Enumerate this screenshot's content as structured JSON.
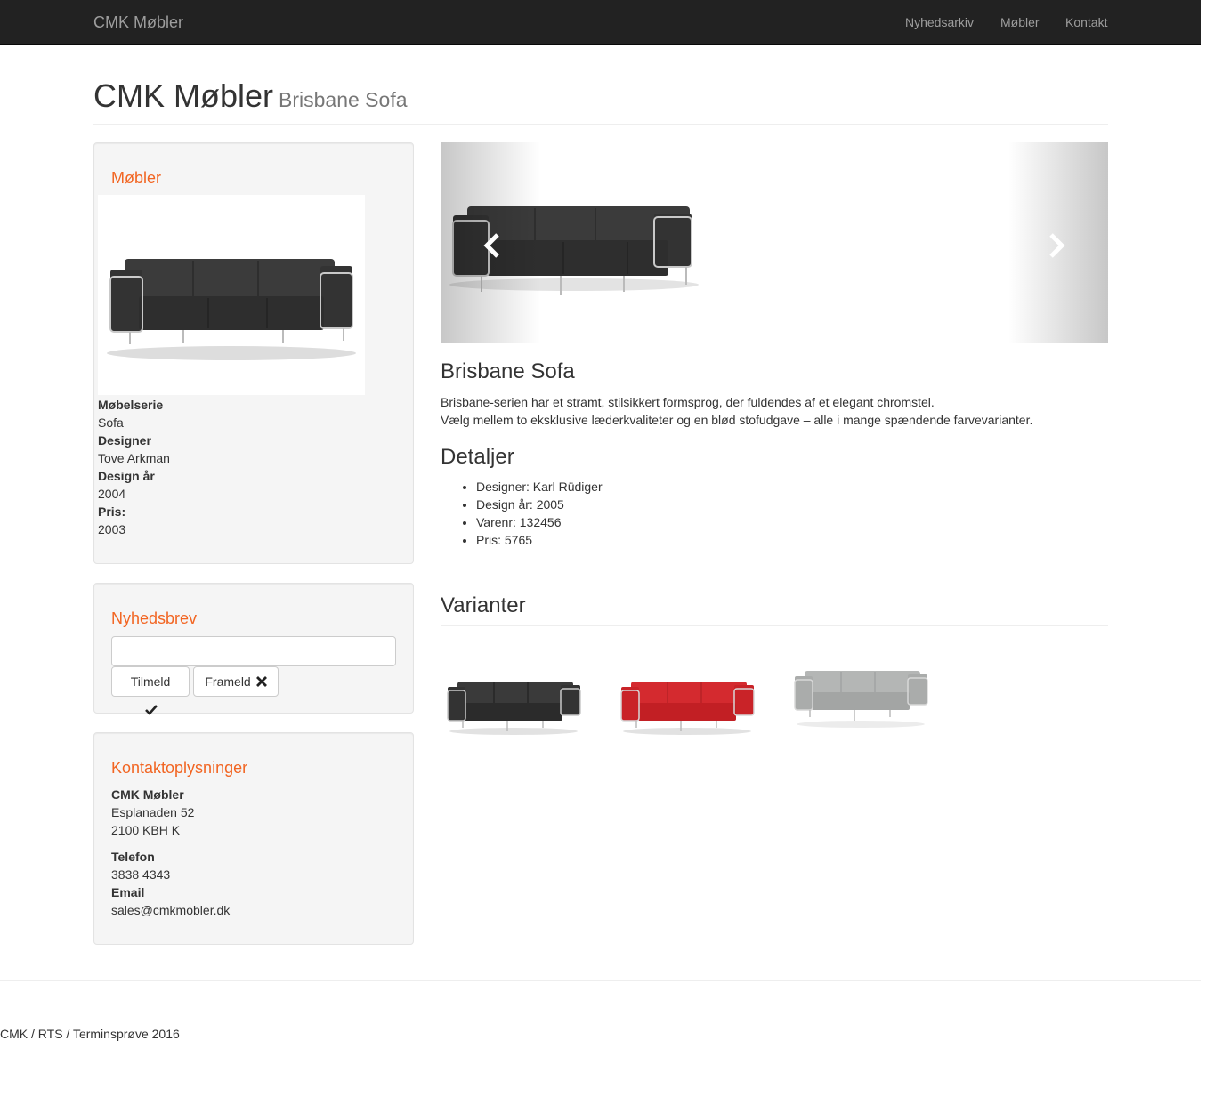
{
  "navbar": {
    "brand": "CMK Møbler",
    "links": [
      "Nyhedsarkiv",
      "Møbler",
      "Kontakt"
    ]
  },
  "header": {
    "title": "CMK Møbler",
    "subtitle": "Brisbane Sofa"
  },
  "sidebar": {
    "furniture": {
      "title": "Møbler",
      "fields": [
        {
          "label": "Møbelserie",
          "value": "Sofa"
        },
        {
          "label": "Designer",
          "value": "Tove Arkman"
        },
        {
          "label": "Design år",
          "value": "2004"
        },
        {
          "label": "Pris:",
          "value": "2003"
        }
      ]
    },
    "newsletter": {
      "title": "Nyhedsbrev",
      "input_value": "",
      "subscribe_label": "Tilmeld",
      "unsubscribe_label": "Frameld"
    },
    "contact": {
      "title": "Kontaktoplysninger",
      "company": "CMK Møbler",
      "address1": "Esplanaden 52",
      "address2": "2100 KBH K",
      "phone_label": "Telefon",
      "phone": "3838 4343",
      "email_label": "Email",
      "email": "sales@cmkmobler.dk"
    }
  },
  "product": {
    "title": "Brisbane Sofa",
    "description_1": "Brisbane-serien har et stramt, stilsikkert formsprog, der fuldendes af et elegant chromstel.",
    "description_2": "Vælg mellem to eksklusive læderkvaliteter og en blød stofudgave – alle i mange spændende farvevarianter.",
    "details_title": "Detaljer",
    "details": [
      "Designer: Karl Rüdiger",
      "Design år: 2005",
      "Varenr: 132456",
      "Pris: 5765"
    ]
  },
  "variants": {
    "title": "Varianter",
    "colors": [
      "#3a3a3a",
      "#d42a2f",
      "#b4b6b5"
    ]
  },
  "footer": {
    "text": "CMK / RTS / Terminsprøve 2016"
  },
  "icons": {
    "prev": "chevron-left-icon",
    "next": "chevron-right-icon",
    "subscribe": "check-icon",
    "unsubscribe": "close-icon"
  }
}
